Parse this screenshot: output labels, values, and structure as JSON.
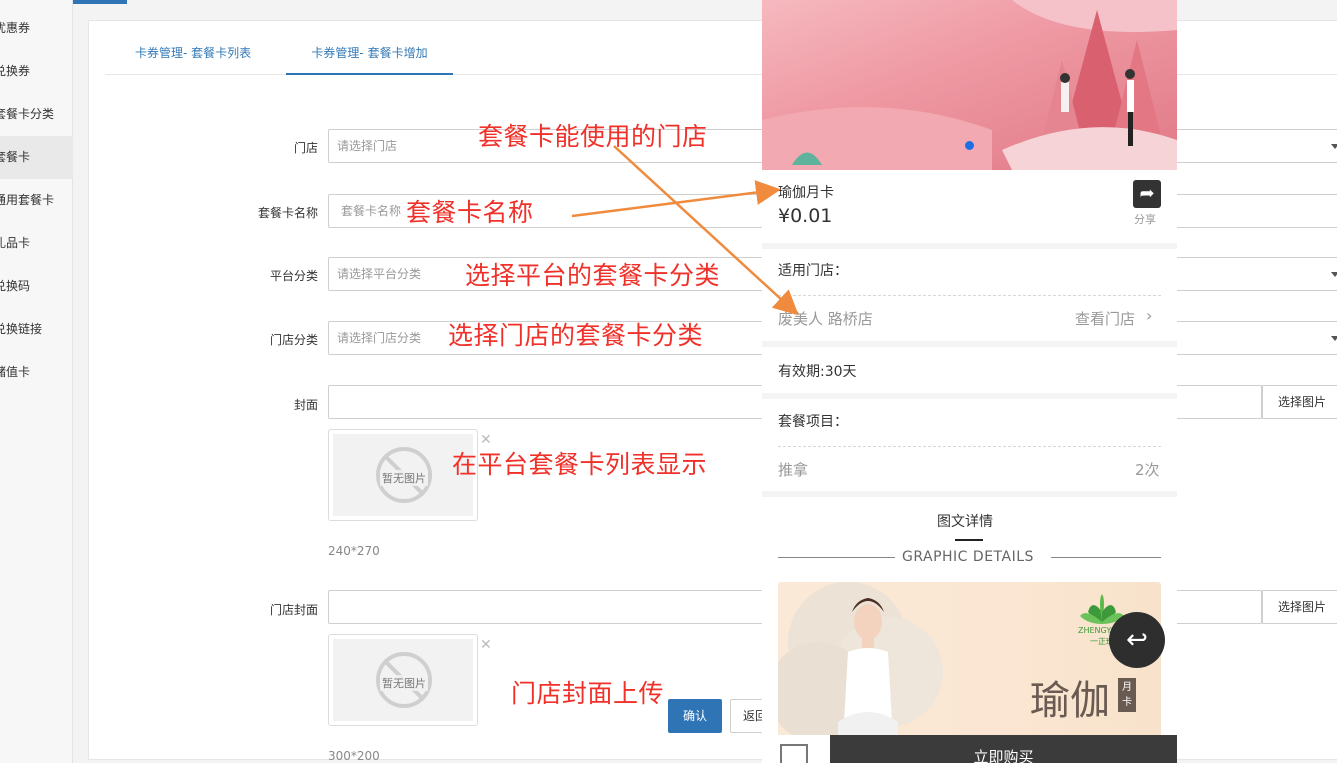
{
  "sidebar": {
    "items": [
      {
        "label": "优惠券",
        "active": false
      },
      {
        "label": "兑换券",
        "active": false
      },
      {
        "label": "套餐卡分类",
        "active": false
      },
      {
        "label": "套餐卡",
        "active": true
      },
      {
        "label": "通用套餐卡",
        "active": false
      },
      {
        "label": "礼品卡",
        "active": false
      },
      {
        "label": "兑换码",
        "active": false
      },
      {
        "label": "兑换链接",
        "active": false
      },
      {
        "label": "储值卡",
        "active": false
      }
    ]
  },
  "tabs": [
    {
      "label": "卡券管理- 套餐卡列表",
      "active": false
    },
    {
      "label": "卡券管理- 套餐卡增加",
      "active": true
    }
  ],
  "form": {
    "store": {
      "label": "门店",
      "placeholder": "请选择门店"
    },
    "card_name": {
      "label": "套餐卡名称",
      "placeholder": "套餐卡名称"
    },
    "platform_category": {
      "label": "平台分类",
      "placeholder": "请选择平台分类"
    },
    "store_category": {
      "label": "门店分类",
      "placeholder": "请选择门店分类"
    },
    "cover": {
      "label": "封面",
      "pick_button": "选择图片",
      "no_image": "暂无图片",
      "size_hint": "240*270"
    },
    "store_cover": {
      "label": "门店封面",
      "pick_button": "选择图片",
      "no_image": "暂无图片",
      "size_hint": "300*200"
    },
    "confirm_button": "确认",
    "back_button": "返回"
  },
  "annotations": {
    "store": "套餐卡能使用的门店",
    "card_name": "套餐卡名称",
    "platform_category": "选择平台的套餐卡分类",
    "store_category": "选择门店的套餐卡分类",
    "cover": "在平台套餐卡列表显示",
    "store_cover": "门店封面上传",
    "color": "#f0312a"
  },
  "phone": {
    "title": "瑜伽月卡",
    "price": "¥0.01",
    "share_label": "分享",
    "stores_heading": "适用门店：",
    "store_name": "废美人 路桥店",
    "view_store": "查看门店",
    "validity": "有效期:30天",
    "items_heading": "套餐项目：",
    "item_name": "推拿",
    "item_count": "2次",
    "details_title": "图文详情",
    "details_subtitle": "GRAPHIC DETAILS",
    "image_text_main": "瑜伽",
    "image_text_tag": "月卡",
    "brand_text": "ZHENGYU",
    "brand_sub": "一正瑜",
    "buy_button": "立即购买",
    "accent": "#1e6fe6"
  }
}
